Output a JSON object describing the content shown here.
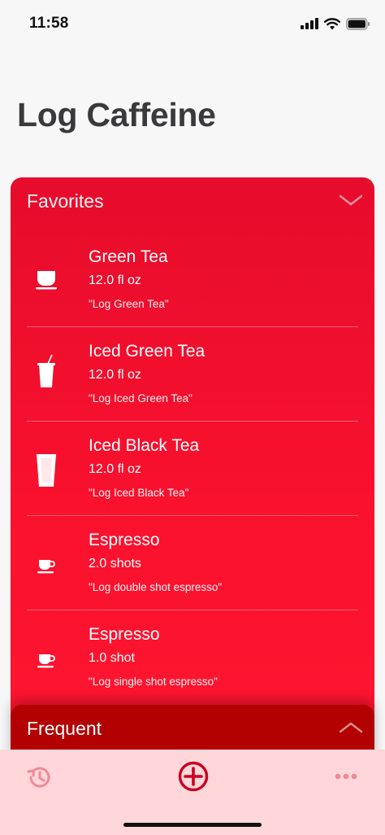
{
  "status_bar": {
    "time": "11:58"
  },
  "title": "Log Caffeine",
  "favorites": {
    "label": "Favorites",
    "items": [
      {
        "name": "Green Tea",
        "amount": "12.0 fl oz",
        "phrase": "\"Log Green Tea\"",
        "icon": "teacup-icon"
      },
      {
        "name": "Iced Green Tea",
        "amount": "12.0 fl oz",
        "phrase": "\"Log Iced Green Tea\"",
        "icon": "iced-cup-straw-icon"
      },
      {
        "name": "Iced Black Tea",
        "amount": "12.0 fl oz",
        "phrase": "\"Log Iced Black Tea\"",
        "icon": "tall-glass-icon"
      },
      {
        "name": "Espresso",
        "amount": "2.0 shots",
        "phrase": "\"Log double shot espresso\"",
        "icon": "espresso-cup-icon"
      },
      {
        "name": "Espresso",
        "amount": "1.0 shot",
        "phrase": "\"Log single shot espresso\"",
        "icon": "espresso-cup-icon"
      }
    ]
  },
  "frequent": {
    "label": "Frequent"
  },
  "tab_bar": {
    "icons": [
      "history-icon",
      "add-circle-icon",
      "more-icon"
    ]
  },
  "colors": {
    "card_red": "#f9112e",
    "frequent_red": "#b30000",
    "tab_bar_bg": "#ffd6d9",
    "tab_icon_light": "#f08a96",
    "tab_icon_active": "#c8001f"
  }
}
